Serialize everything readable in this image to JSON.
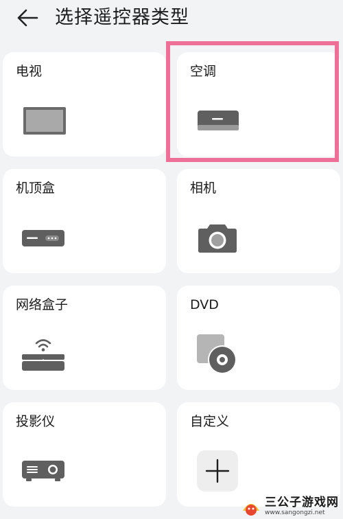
{
  "header": {
    "title": "选择遥控器类型",
    "back_icon": "arrow-left-icon"
  },
  "devices": [
    {
      "id": "tv",
      "label": "电视",
      "icon": "tv-icon"
    },
    {
      "id": "ac",
      "label": "空调",
      "icon": "air-conditioner-icon"
    },
    {
      "id": "stb",
      "label": "机顶盒",
      "icon": "set-top-box-icon"
    },
    {
      "id": "camera",
      "label": "相机",
      "icon": "camera-icon"
    },
    {
      "id": "netbox",
      "label": "网络盒子",
      "icon": "network-box-icon"
    },
    {
      "id": "dvd",
      "label": "DVD",
      "icon": "dvd-icon"
    },
    {
      "id": "projector",
      "label": "投影仪",
      "icon": "projector-icon"
    },
    {
      "id": "custom",
      "label": "自定义",
      "icon": "plus-icon"
    }
  ],
  "highlight_color": "#ee6f97",
  "icon_color": "#5f5f5f",
  "watermark": {
    "text": "三公子游戏网",
    "url": "www.sangongzi.net"
  }
}
